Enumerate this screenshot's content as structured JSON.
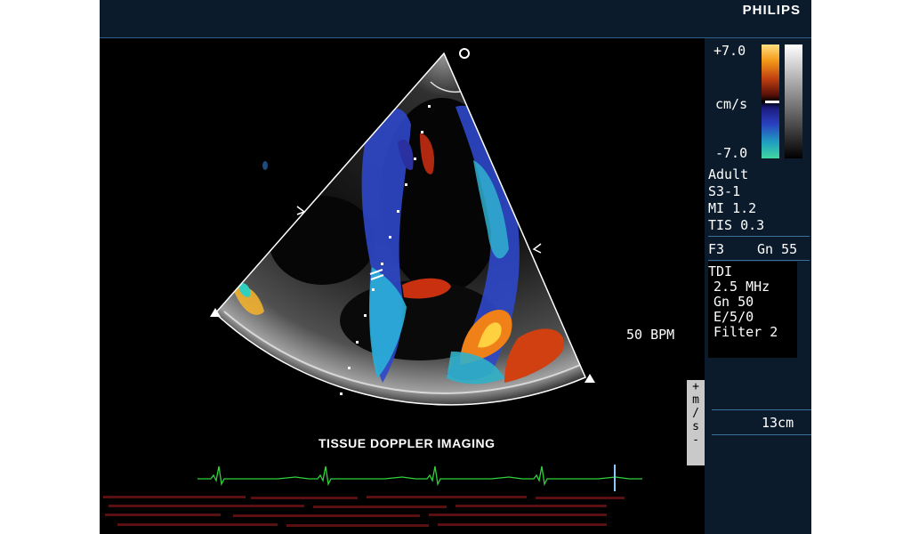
{
  "header": {
    "brand": "PHILIPS"
  },
  "color_scale": {
    "max_label": "+7.0",
    "unit_label": "cm/s",
    "min_label": "-7.0"
  },
  "probe_info": {
    "preset": "Adult",
    "transducer": "S3-1",
    "mi": "MI 1.2",
    "tis": "TIS 0.3",
    "frame": "F3",
    "gain": "Gn 55"
  },
  "tdi_info": {
    "mode": "TDI",
    "frequency": "2.5 MHz",
    "gain": "Gn 50",
    "settings": "E/5/0",
    "filter": "Filter 2"
  },
  "heart_rate": "50 BPM",
  "depth": "13cm",
  "sweep_speed": {
    "chars": [
      "+",
      "m",
      "/",
      "s",
      "-"
    ]
  },
  "caption": "TISSUE DOPPLER IMAGING",
  "colors": {
    "panel": "#0c1b2b",
    "ecg": "#2fd23a",
    "accent_line": "#3b6f9c"
  }
}
